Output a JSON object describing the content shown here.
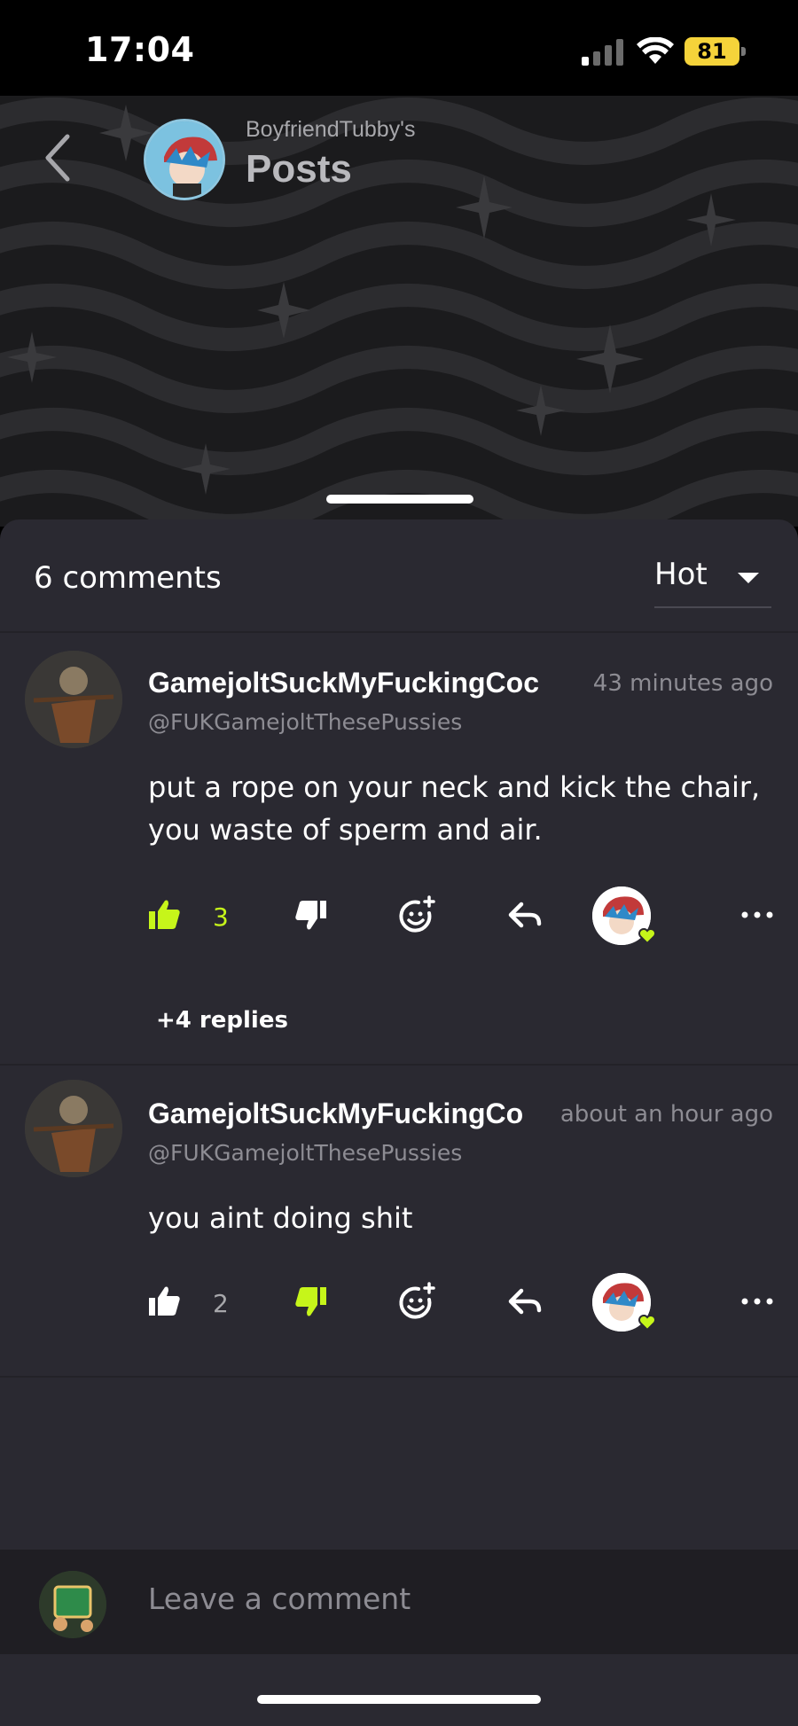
{
  "status_bar": {
    "time": "17:04",
    "battery": "81"
  },
  "header": {
    "subtitle": "BoyfriendTubby's",
    "title": "Posts"
  },
  "comments_header": {
    "count_label": "6 comments",
    "sort_value": "Hot"
  },
  "comments": [
    {
      "name": "GamejoltSuckMyFuckingCoc",
      "handle": "@FUKGamejoltThesePussies",
      "time": "43 minutes ago",
      "body": "put a rope on your neck and kick the chair, you waste of sperm and air.",
      "likes": "3",
      "replies": "+4 replies"
    },
    {
      "name": "GamejoltSuckMyFuckingCo",
      "handle": "@FUKGamejoltThesePussies",
      "time": "about an hour ago",
      "body": "you aint doing shit",
      "likes": "2"
    }
  ],
  "composer": {
    "placeholder": "Leave a comment"
  },
  "colors": {
    "accent": "#c6f51a",
    "sheet": "#2a2931",
    "battery": "#f5d33a"
  }
}
